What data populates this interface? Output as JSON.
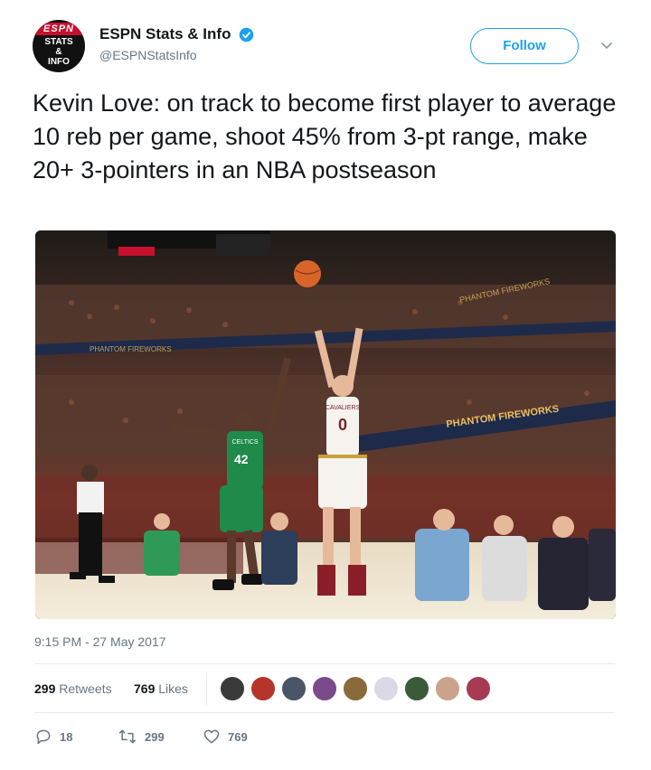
{
  "account": {
    "avatar_logo_text": "ESPN",
    "avatar_sub_text": "STATS & INFO",
    "display_name": "ESPN Stats & Info",
    "handle": "@ESPNStatsInfo",
    "verified": true
  },
  "follow_label": "Follow",
  "tweet": {
    "text": "Kevin Love: on track to become first player to average 10 reb per game, shoot 45% from 3-pt range, make 20+ 3-pointers in an NBA postseason",
    "timestamp": "9:15 PM - 27 May 2017"
  },
  "photo": {
    "arena_ads": [
      "PHANTOM FIREWORKS",
      "PHANTOM FIREWORKS",
      "PHANTOM FIREWORKS"
    ],
    "jersey_left_team": "CELTICS",
    "jersey_left_number": "42",
    "jersey_right_team": "CAVALIERS",
    "jersey_right_number": "0"
  },
  "stats": {
    "retweets_count": "299",
    "retweets_label": "Retweets",
    "likes_count": "769",
    "likes_label": "Likes"
  },
  "likers": [
    "#3a3a3a",
    "#b5352b",
    "#4a5568",
    "#7b4a8a",
    "#8a6a3a",
    "#d9d9e8",
    "#3a5a3a",
    "#c9a48a",
    "#a53a52"
  ],
  "actions": {
    "replies": "18",
    "retweets": "299",
    "likes": "769"
  },
  "colors": {
    "accent": "#1da1f2",
    "text": "#14171a",
    "muted": "#657786",
    "espn_red": "#c8102e"
  }
}
